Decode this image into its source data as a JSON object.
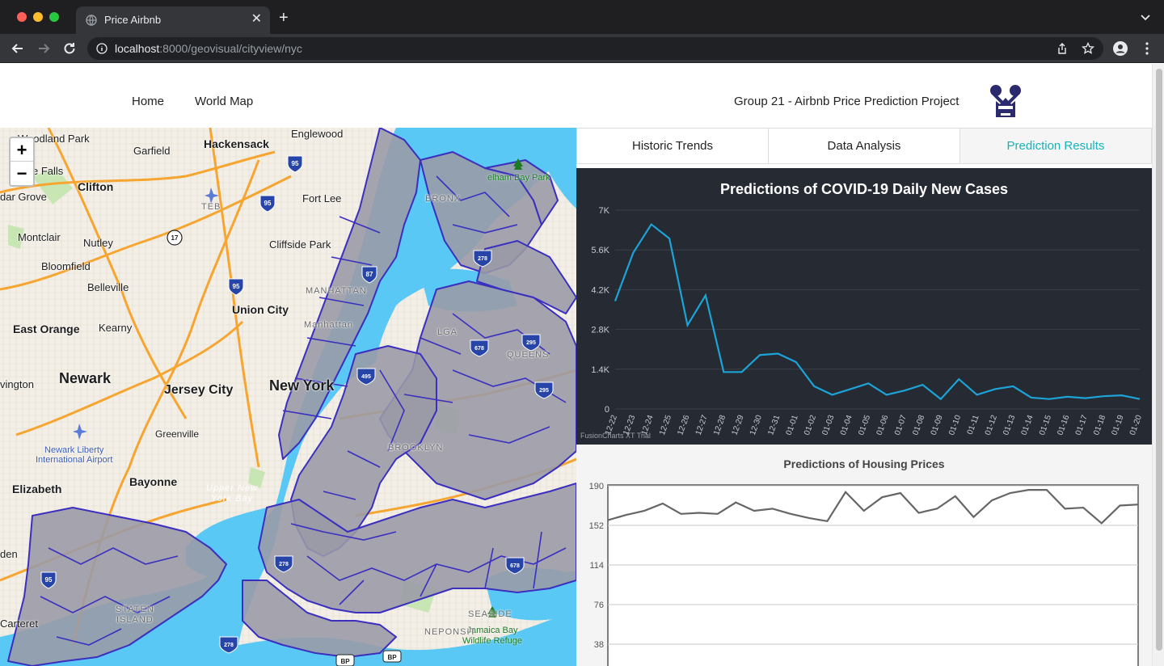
{
  "browser": {
    "tab_title": "Price Airbnb",
    "url_host": "localhost",
    "url_path": ":8000/geovisual/cityview/nyc"
  },
  "nav": {
    "home": "Home",
    "world_map": "World Map",
    "project_title": "Group 21 - Airbnb Price Prediction Project"
  },
  "map": {
    "zoom_in": "+",
    "zoom_out": "−",
    "labels": {
      "woodland_park": "Woodland Park",
      "garfield": "Garfield",
      "hackensack": "Hackensack",
      "englewood": "Englewood",
      "little_falls": "e Falls",
      "cedar_grove": "dar Grove",
      "clifton": "Clifton",
      "teb": "TEB",
      "fort_lee": "Fort Lee",
      "montclair": "Montclair",
      "nutley": "Nutley",
      "cliffside_park": "Cliffside Park",
      "bloomfield": "Bloomfield",
      "belleville": "Belleville",
      "union_city": "Union City",
      "manhattan": "MANHATTAN",
      "east_orange": "East Orange",
      "kearny": "Kearny",
      "irvington": "vington",
      "newark": "Newark",
      "jersey_city": "Jersey City",
      "new_york": "New York",
      "queens": "QUEENS",
      "greenville": "Greenville",
      "newark_airport": "Newark Liberty\nInternational Airport",
      "bayonne": "Bayonne",
      "elizabeth": "Elizabeth",
      "upper_ny_bay": "Upper New\nYork Bay",
      "linden": "den",
      "staten_island": "STATEN\nISLAND",
      "carteret": "Carteret",
      "jamaica_bay": "Jamaica Bay\nWildlife Refuge",
      "pelham_bay": "elham Bay Park",
      "seaside": "SEASIDE",
      "neponsit": "NEPONSIT",
      "lga": "LGA",
      "bronx": "BRONX",
      "brooklyn": "BROOKLYN",
      "manhattan_small": "Manhattan"
    },
    "shields": [
      "95",
      "95",
      "17",
      "95",
      "278",
      "495",
      "678",
      "295",
      "295",
      "678",
      "278",
      "278",
      "95",
      "BP",
      "BP",
      "87"
    ],
    "colors": {
      "water": "#5ac8f4",
      "land": "#f3efe6",
      "region_fill": "#9a9aa6",
      "region_stroke": "#3a2fbf",
      "highway": "#f6a531",
      "park": "#c8e6b4"
    }
  },
  "tabs": {
    "historic": "Historic Trends",
    "analysis": "Data Analysis",
    "prediction": "Prediction Results"
  },
  "charts": {
    "trial_text": "FusionCharts XT Trial"
  },
  "chart_data": [
    {
      "type": "line",
      "title": "Predictions of COVID-19 Daily New Cases",
      "categories": [
        "12-22",
        "12-23",
        "12-24",
        "12-25",
        "12-26",
        "12-27",
        "12-28",
        "12-29",
        "12-30",
        "12-31",
        "01-01",
        "01-02",
        "01-03",
        "01-04",
        "01-05",
        "01-06",
        "01-07",
        "01-08",
        "01-09",
        "01-10",
        "01-11",
        "01-12",
        "01-13",
        "01-14",
        "01-15",
        "01-16",
        "01-17",
        "01-18",
        "01-19",
        "01-20"
      ],
      "values": [
        3800,
        5500,
        6500,
        6000,
        2950,
        4000,
        1300,
        1300,
        1900,
        1950,
        1650,
        800,
        500,
        700,
        900,
        500,
        650,
        850,
        350,
        1050,
        500,
        700,
        800,
        400,
        350,
        430,
        380,
        450,
        480,
        350
      ],
      "yticks": [
        "0",
        "1.4K",
        "2.8K",
        "4.2K",
        "5.6K",
        "7K"
      ],
      "ylim": [
        0,
        7000
      ],
      "line_color": "#1ca4d8",
      "background": "#262a33",
      "grid": true
    },
    {
      "type": "line",
      "title": "Predictions of Housing Prices",
      "values": [
        157,
        162,
        166,
        173,
        163,
        164,
        163,
        174,
        166,
        168,
        163,
        159,
        156,
        184,
        166,
        179,
        183,
        164,
        168,
        180,
        160,
        176,
        183,
        186,
        186,
        168,
        169,
        154,
        171,
        172
      ],
      "yticks": [
        "38",
        "76",
        "114",
        "152",
        "190"
      ],
      "ylim": [
        0,
        190
      ],
      "line_color": "#666666",
      "grid": true
    }
  ]
}
